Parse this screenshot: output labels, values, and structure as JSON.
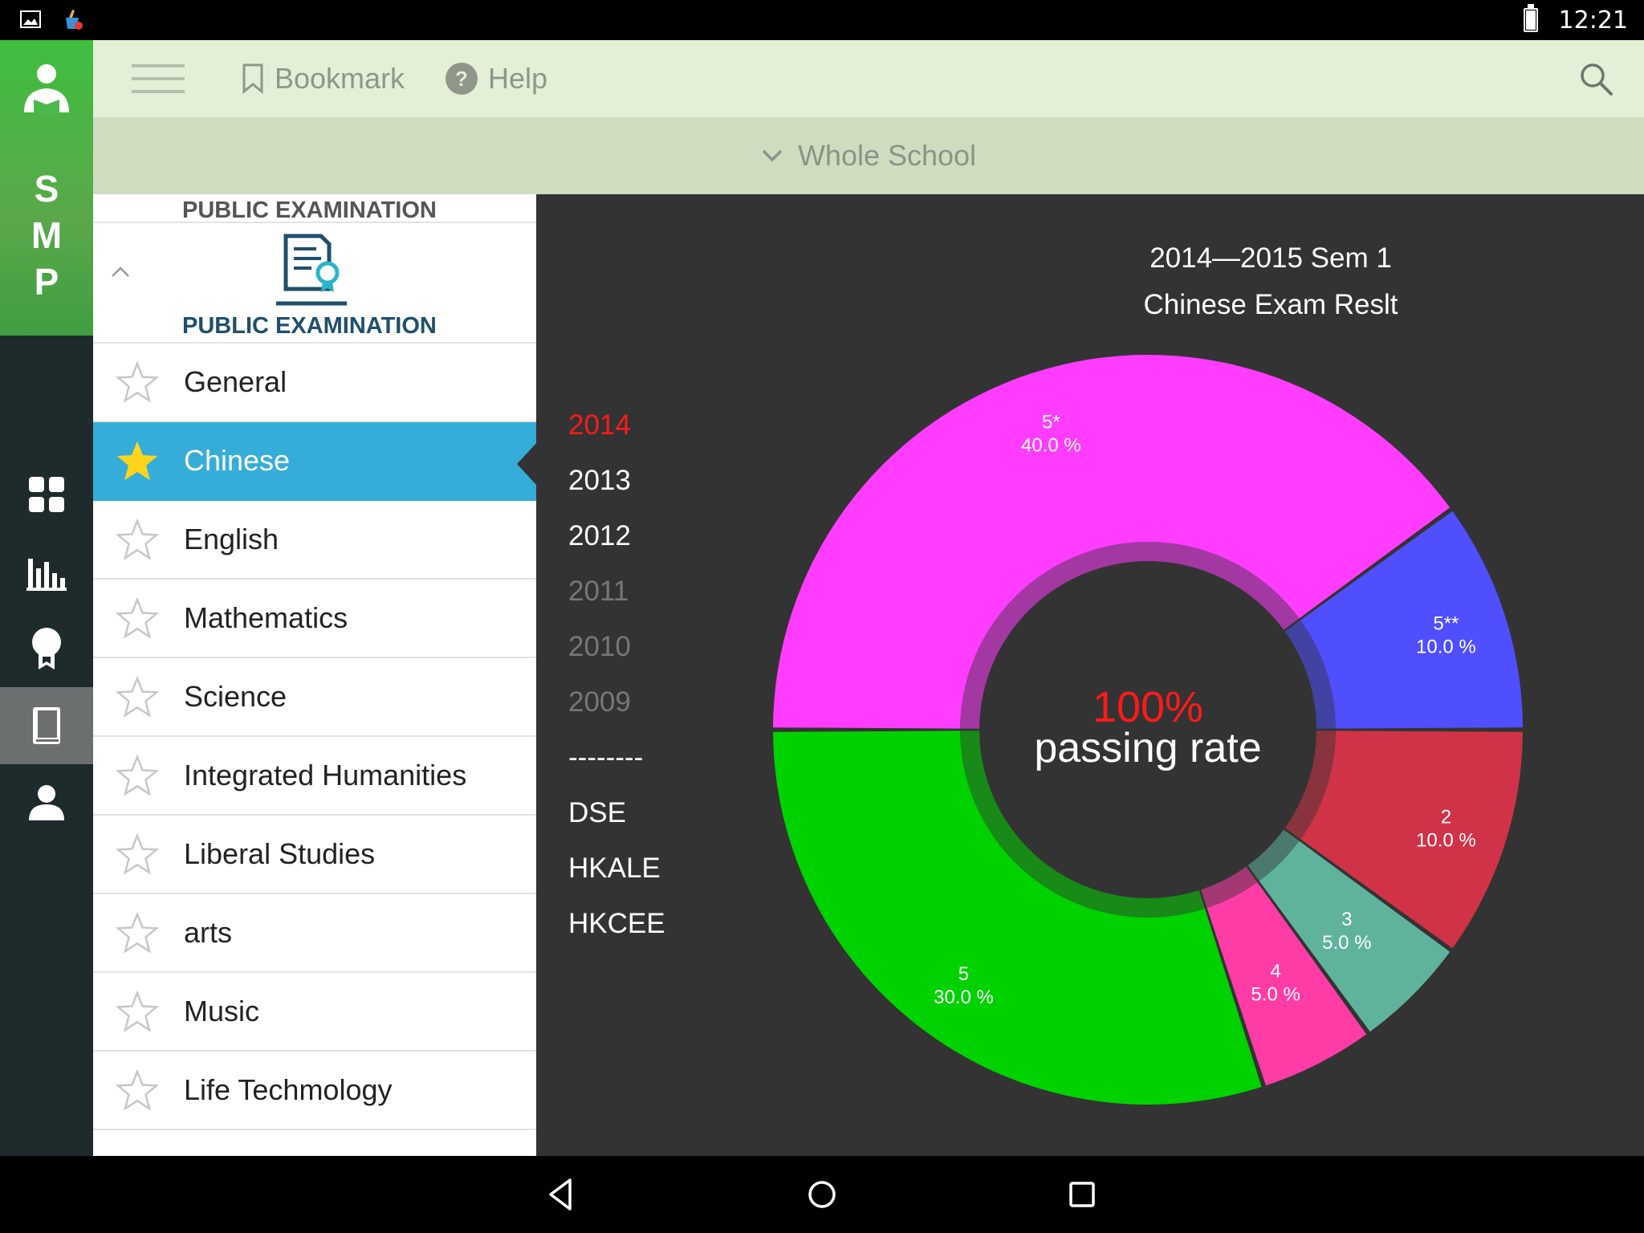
{
  "status_bar": {
    "time": "12:21"
  },
  "rail": {
    "logo_letters": [
      "S",
      "M",
      "P"
    ],
    "items": [
      {
        "icon": "dashboard-grid-icon",
        "active": false
      },
      {
        "icon": "bar-chart-icon",
        "active": false
      },
      {
        "icon": "award-badge-icon",
        "active": false
      },
      {
        "icon": "book-icon",
        "active": true
      },
      {
        "icon": "person-icon",
        "active": false
      }
    ]
  },
  "appbar": {
    "bookmark_label": "Bookmark",
    "help_label": "Help"
  },
  "filter": {
    "label": "Whole School"
  },
  "panel": {
    "header_label": "PUBLIC EXAMINATION",
    "section_title": "PUBLIC EXAMINATION",
    "subjects": [
      {
        "label": "General",
        "starred": false,
        "selected": false
      },
      {
        "label": "Chinese",
        "starred": true,
        "selected": true
      },
      {
        "label": "English",
        "starred": false,
        "selected": false
      },
      {
        "label": "Mathematics",
        "starred": false,
        "selected": false
      },
      {
        "label": "Science",
        "starred": false,
        "selected": false
      },
      {
        "label": "Integrated Humanities",
        "starred": false,
        "selected": false
      },
      {
        "label": "Liberal Studies",
        "starred": false,
        "selected": false
      },
      {
        "label": "arts",
        "starred": false,
        "selected": false
      },
      {
        "label": "Music",
        "starred": false,
        "selected": false
      },
      {
        "label": "Life Techmology",
        "starred": false,
        "selected": false
      }
    ]
  },
  "years": {
    "items": [
      {
        "label": "2014",
        "state": "active"
      },
      {
        "label": "2013",
        "state": "normal"
      },
      {
        "label": "2012",
        "state": "normal"
      },
      {
        "label": "2011",
        "state": "dim"
      },
      {
        "label": "2010",
        "state": "dim"
      },
      {
        "label": "2009",
        "state": "dim"
      },
      {
        "label": "--------",
        "state": "normal"
      },
      {
        "label": "DSE",
        "state": "normal"
      },
      {
        "label": "HKALE",
        "state": "normal"
      },
      {
        "label": "HKCEE",
        "state": "normal"
      }
    ]
  },
  "chart_data": {
    "type": "pie",
    "title": "2014—2015 Sem 1",
    "subtitle": "Chinese Exam Reslt",
    "center_value": "100%",
    "center_label": "passing rate",
    "categories": [
      "5*",
      "5**",
      "2",
      "3",
      "4",
      "5"
    ],
    "values": [
      40.0,
      10.0,
      10.0,
      5.0,
      5.0,
      30.0
    ],
    "value_labels": [
      "40.0 %",
      "10.0 %",
      "10.0 %",
      "5.0 %",
      "5.0 %",
      "30.0 %"
    ],
    "colors": [
      "#ff3cff",
      "#4f4fff",
      "#d03347",
      "#5fb39c",
      "#ff3ca6",
      "#00d200"
    ]
  }
}
